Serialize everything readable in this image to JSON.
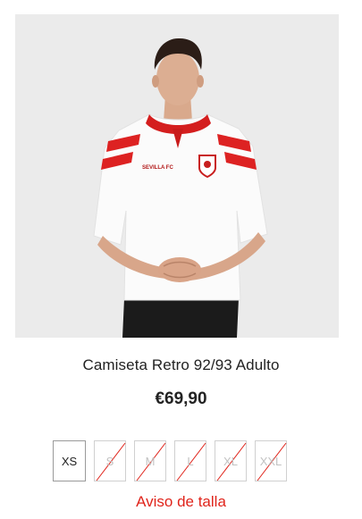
{
  "product": {
    "image_alt": "Camiseta Retro 92/93 Adulto",
    "name": "Camiseta Retro 92/93 Adulto",
    "price": "€69,90",
    "shirt_wordmark": "SEVILLA FC",
    "accent_color": "#e0241b"
  },
  "sizes": [
    {
      "label": "XS",
      "available": true
    },
    {
      "label": "S",
      "available": false
    },
    {
      "label": "M",
      "available": false
    },
    {
      "label": "L",
      "available": false
    },
    {
      "label": "XL",
      "available": false
    },
    {
      "label": "XXL",
      "available": false
    }
  ],
  "size_notice": "Aviso de talla"
}
